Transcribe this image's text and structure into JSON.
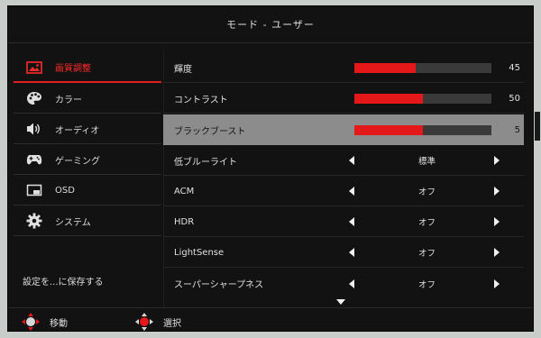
{
  "title": "モード - ユーザー",
  "accent_color": "#e41818",
  "sidebar": {
    "items": [
      {
        "label": "画質調整",
        "icon": "picture-icon",
        "active": true
      },
      {
        "label": "カラー",
        "icon": "palette-icon",
        "active": false
      },
      {
        "label": "オーディオ",
        "icon": "speaker-icon",
        "active": false
      },
      {
        "label": "ゲーミング",
        "icon": "gamepad-icon",
        "active": false
      },
      {
        "label": "OSD",
        "icon": "osd-icon",
        "active": false
      },
      {
        "label": "システム",
        "icon": "gear-icon",
        "active": false
      }
    ],
    "save_label": "設定を...に保存する"
  },
  "settings": [
    {
      "label": "輝度",
      "type": "slider",
      "value": "45",
      "level_fraction": 0.45
    },
    {
      "label": "コントラスト",
      "type": "slider",
      "value": "50",
      "level_fraction": 0.5
    },
    {
      "label": "ブラックブースト",
      "type": "slider",
      "value": "5",
      "level_fraction": 0.5,
      "highlighted": true
    },
    {
      "label": "低ブルーライト",
      "type": "option",
      "value": "標準"
    },
    {
      "label": "ACM",
      "type": "option",
      "value": "オフ"
    },
    {
      "label": "HDR",
      "type": "option",
      "value": "オフ"
    },
    {
      "label": "LightSense",
      "type": "option",
      "value": "オフ"
    },
    {
      "label": "スーパーシャープネス",
      "type": "option",
      "value": "オフ"
    }
  ],
  "footer": {
    "move_label": "移動",
    "select_label": "選択"
  }
}
